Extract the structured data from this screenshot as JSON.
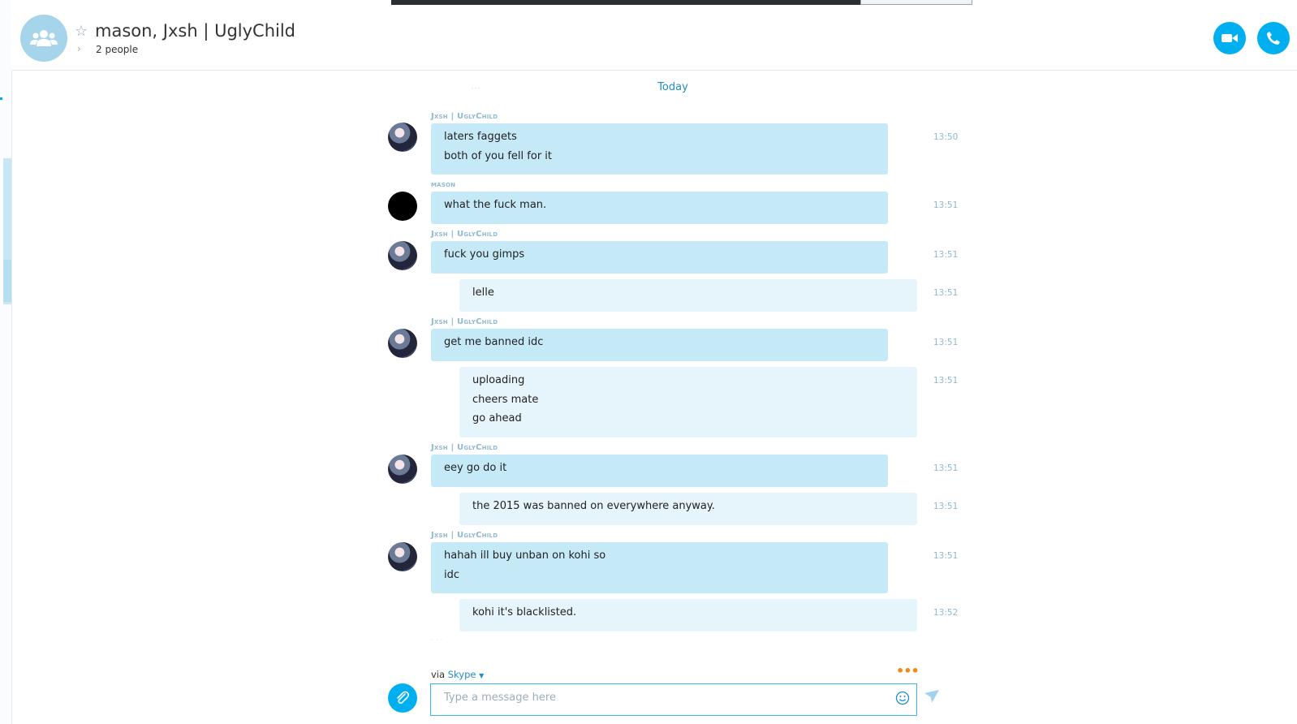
{
  "header": {
    "title": "mason, Jxsh | UglyChild",
    "people_count": "2 people"
  },
  "conversation": {
    "date_divider": "Today",
    "messages": [
      {
        "sender": "Jxsh | UglyChild",
        "side": "left",
        "avatar": "anime",
        "lines": [
          "laters faggets",
          "both of you fell for it"
        ],
        "time": "13:50"
      },
      {
        "sender": "mason",
        "side": "left",
        "avatar": "black",
        "lines": [
          "what the fuck man."
        ],
        "time": "13:51"
      },
      {
        "sender": "Jxsh | UglyChild",
        "side": "left",
        "avatar": "anime",
        "lines": [
          "fuck you gimps"
        ],
        "time": "13:51"
      },
      {
        "sender": "",
        "side": "right",
        "avatar": "",
        "lines": [
          "lelle"
        ],
        "time": "13:51"
      },
      {
        "sender": "Jxsh | UglyChild",
        "side": "left",
        "avatar": "anime",
        "lines": [
          "get me banned idc"
        ],
        "time": "13:51"
      },
      {
        "sender": "",
        "side": "right",
        "avatar": "",
        "lines": [
          "uploading",
          "cheers mate",
          "go ahead"
        ],
        "time": "13:51"
      },
      {
        "sender": "Jxsh | UglyChild",
        "side": "left",
        "avatar": "anime",
        "lines": [
          "eey go do it"
        ],
        "time": "13:51"
      },
      {
        "sender": "",
        "side": "right",
        "avatar": "",
        "lines": [
          "the 2015 was banned on everywhere anyway."
        ],
        "time": "13:51"
      },
      {
        "sender": "Jxsh | UglyChild",
        "side": "left",
        "avatar": "anime",
        "lines": [
          "hahah ill buy unban on kohi so",
          "idc"
        ],
        "time": "13:51"
      },
      {
        "sender": "",
        "side": "right",
        "avatar": "",
        "lines": [
          "kohi it's blacklisted."
        ],
        "time": "13:52"
      }
    ]
  },
  "composer": {
    "via_label": "via",
    "via_service": "Skype",
    "placeholder": "Type a message here",
    "value": ""
  },
  "colors": {
    "accent": "#00aff0",
    "incoming_bubble": "#c5e9f7",
    "outgoing_bubble": "#e6f5fb",
    "typing_dots": "#f08a1a"
  },
  "icons": [
    "group-avatar-icon",
    "star-icon",
    "chevron-right-icon",
    "video-call-icon",
    "phone-call-icon",
    "paperclip-icon",
    "emoji-icon",
    "send-icon",
    "more-dots-icon",
    "dropdown-caret-icon"
  ]
}
